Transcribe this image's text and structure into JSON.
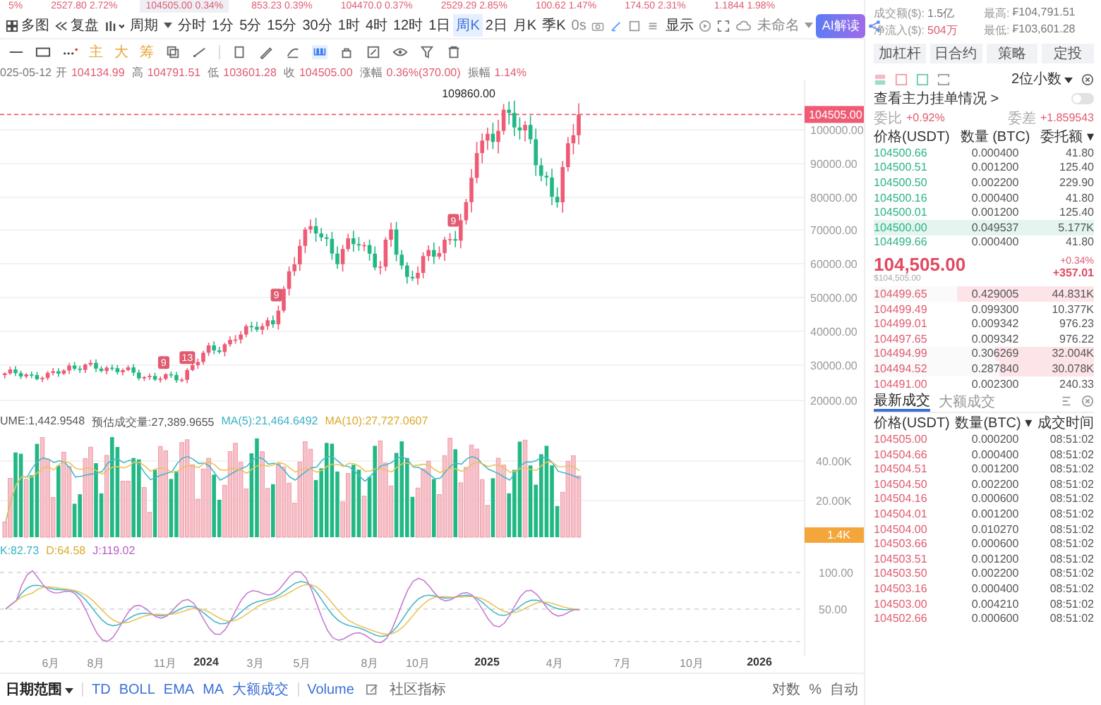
{
  "ticker": [
    {
      "text": "5%",
      "selected": false
    },
    {
      "text": "2527.80 2.72%",
      "selected": false
    },
    {
      "text": "104505.00 0.34%",
      "selected": true
    },
    {
      "text": "853.23 0.39%",
      "selected": false
    },
    {
      "text": "104470.0 0.37%",
      "selected": false
    },
    {
      "text": "2529.29 2.85%",
      "selected": false
    },
    {
      "text": "100.62 1.47%",
      "selected": false
    },
    {
      "text": "174.50 2.31%",
      "selected": false
    },
    {
      "text": "1.1844 1.98%",
      "selected": false
    }
  ],
  "toolbar": {
    "multi": "多图",
    "replay": "复盘",
    "period": "周期",
    "intervals": [
      {
        "label": "分时",
        "selected": false
      },
      {
        "label": "1分",
        "selected": false
      },
      {
        "label": "5分",
        "selected": false
      },
      {
        "label": "15分",
        "selected": false
      },
      {
        "label": "30分",
        "selected": false
      },
      {
        "label": "1时",
        "selected": false
      },
      {
        "label": "4时",
        "selected": false
      },
      {
        "label": "12时",
        "selected": false
      },
      {
        "label": "1日",
        "selected": false
      },
      {
        "label": "周K",
        "selected": true
      },
      {
        "label": "2日",
        "selected": false
      },
      {
        "label": "月K",
        "selected": false
      },
      {
        "label": "季K",
        "selected": false
      }
    ],
    "refresh": "0s",
    "display": "显示",
    "layout": "未命名",
    "ai": "AI解读"
  },
  "tools": [
    "主",
    "大",
    "筹"
  ],
  "info_date": "025-05-12",
  "info": [
    {
      "label": "开",
      "value": "104134.99"
    },
    {
      "label": "高",
      "value": "104791.51"
    },
    {
      "label": "低",
      "value": "103601.28"
    },
    {
      "label": "收",
      "value": "104505.00"
    },
    {
      "label": "涨幅",
      "value": "0.36%(370.00)"
    },
    {
      "label": "振幅",
      "value": "1.14%"
    }
  ],
  "chart": {
    "high_label": "109860.00",
    "last_price": "104505.00",
    "price_axis": [
      "100000.00",
      "90000.00",
      "80000.00",
      "70000.00",
      "60000.00",
      "50000.00",
      "40000.00",
      "30000.00",
      "20000.00"
    ],
    "markers": [
      {
        "label": "9"
      },
      {
        "label": "13"
      },
      {
        "label": "9"
      },
      {
        "label": "9"
      }
    ]
  },
  "volume": {
    "legend": [
      "UME:1,442.9548",
      "预估成交量:27,389.9655",
      "MA(5):21,464.6492",
      "MA(10):27,727.0607"
    ],
    "axis": [
      "40.00K",
      "20.00K"
    ],
    "current": "1.4K"
  },
  "kdj": {
    "legend": [
      "K:82.73",
      "D:64.58",
      "J:119.02"
    ],
    "axis": [
      "100.00",
      "50.00"
    ]
  },
  "x_axis": [
    "6月",
    "8月",
    "11月",
    "2024",
    "3月",
    "5月",
    "8月",
    "10月",
    "2025",
    "4月",
    "7月",
    "10月",
    "2026"
  ],
  "bottom_bar": {
    "range": "日期范围",
    "indicators": [
      "TD",
      "BOLL",
      "EMA",
      "MA",
      "大额成交"
    ],
    "volume": "Volume",
    "community": "社区指标",
    "right": [
      "对数",
      "%",
      "自动"
    ]
  },
  "stats": [
    {
      "label": "成交额($):",
      "value": "1.5亿"
    },
    {
      "label": "最高:",
      "value": "₣104,791.51"
    },
    {
      "label": "净流入($):",
      "value": "504万"
    },
    {
      "label": "最低:",
      "value": "₣103,601.28"
    }
  ],
  "actions": [
    "加杠杆",
    "日合约",
    "策略",
    "定投"
  ],
  "orderbook": {
    "precision": "2位小数",
    "main_orders": {
      "label": "查看主力挂单情况 >",
      "on": false
    },
    "ratio_label": "委比",
    "ratio": "+0.92%",
    "diff_label": "委差",
    "diff": "+1.859543",
    "columns": [
      "价格(USDT)",
      "数量 (BTC)",
      "委托额 ▾"
    ],
    "asks": [
      {
        "price": "104500.66",
        "qty": "0.000400",
        "amount": "41.80",
        "selected": false
      },
      {
        "price": "104500.51",
        "qty": "0.001200",
        "amount": "125.40",
        "selected": false
      },
      {
        "price": "104500.50",
        "qty": "0.002200",
        "amount": "229.90",
        "selected": false
      },
      {
        "price": "104500.16",
        "qty": "0.000400",
        "amount": "41.80",
        "selected": false
      },
      {
        "price": "104500.01",
        "qty": "0.001200",
        "amount": "125.40",
        "selected": false
      },
      {
        "price": "104500.00",
        "qty": "0.049537",
        "amount": "5.177K",
        "selected": true
      },
      {
        "price": "104499.66",
        "qty": "0.000400",
        "amount": "41.80",
        "selected": false
      }
    ],
    "last": "104,505.00",
    "last_usd": "$104,505.00",
    "change_pct": "+0.34%",
    "change": "+357.01",
    "bids": [
      {
        "price": "104499.65",
        "qty": "0.429005",
        "amount": "44.831K",
        "level": 0.62
      },
      {
        "price": "104499.49",
        "qty": "0.099300",
        "amount": "10.377K"
      },
      {
        "price": "104499.01",
        "qty": "0.009342",
        "amount": "976.23"
      },
      {
        "price": "104497.65",
        "qty": "0.009342",
        "amount": "976.22"
      },
      {
        "price": "104494.99",
        "qty": "0.306269",
        "amount": "32.004K",
        "level": 0.45
      },
      {
        "price": "104494.52",
        "qty": "0.287840",
        "amount": "30.078K",
        "level": 0.43
      },
      {
        "price": "104491.00",
        "qty": "0.002300",
        "amount": "240.33"
      }
    ]
  },
  "trades": {
    "tabs": [
      {
        "label": "最新成交",
        "selected": true
      },
      {
        "label": "大额成交",
        "selected": false
      }
    ],
    "columns": [
      "价格(USDT)",
      "数量(BTC) ▾",
      "成交时间"
    ],
    "rows": [
      {
        "price": "104505.00",
        "qty": "0.000200",
        "time": "08:51:02"
      },
      {
        "price": "104504.66",
        "qty": "0.000400",
        "time": "08:51:02"
      },
      {
        "price": "104504.51",
        "qty": "0.001200",
        "time": "08:51:02"
      },
      {
        "price": "104504.50",
        "qty": "0.002200",
        "time": "08:51:02"
      },
      {
        "price": "104504.16",
        "qty": "0.000600",
        "time": "08:51:02"
      },
      {
        "price": "104504.01",
        "qty": "0.001200",
        "time": "08:51:02"
      },
      {
        "price": "104504.00",
        "qty": "0.010270",
        "time": "08:51:02"
      },
      {
        "price": "104503.66",
        "qty": "0.000600",
        "time": "08:51:02"
      },
      {
        "price": "104503.51",
        "qty": "0.001200",
        "time": "08:51:02"
      },
      {
        "price": "104503.50",
        "qty": "0.002200",
        "time": "08:51:02"
      },
      {
        "price": "104503.16",
        "qty": "0.000400",
        "time": "08:51:02"
      },
      {
        "price": "104503.00",
        "qty": "0.004210",
        "time": "08:51:02"
      },
      {
        "price": "104502.66",
        "qty": "0.000600",
        "time": "08:51:02"
      }
    ]
  }
}
